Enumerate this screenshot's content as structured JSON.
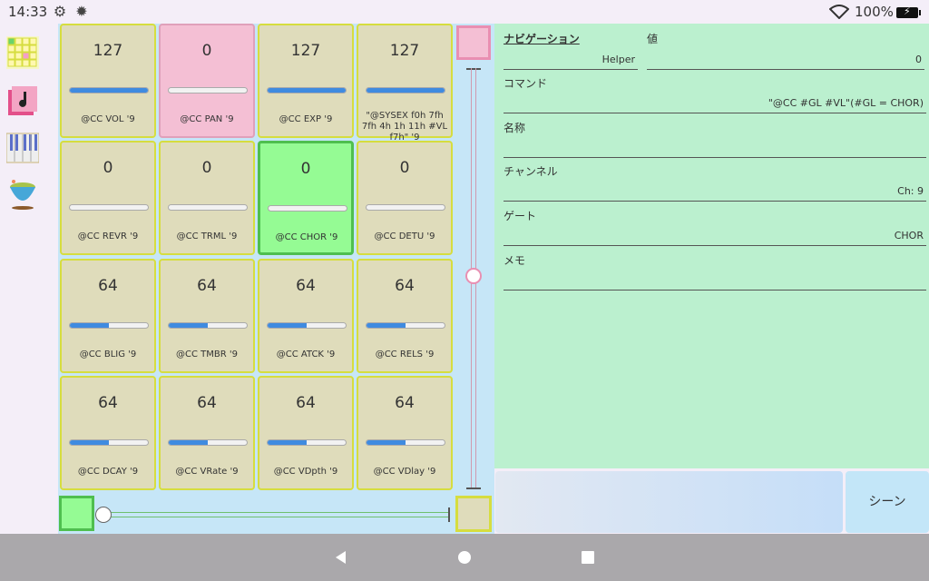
{
  "status": {
    "time": "14:33",
    "battery_pct": "100%",
    "icons": [
      "settings-gear-outline-icon",
      "settings-gear-icon",
      "wifi-icon",
      "battery-charging-icon"
    ]
  },
  "rail": {
    "apps": [
      "pad-grid-app-icon",
      "music-note-app-icon",
      "piano-keyboard-app-icon",
      "tea-bowl-app-icon"
    ]
  },
  "pads": [
    {
      "value": "127",
      "level": 1.0,
      "name": "@CC VOL '9",
      "style": "normal"
    },
    {
      "value": "0",
      "level": 0.0,
      "name": "@CC PAN '9",
      "style": "pink"
    },
    {
      "value": "127",
      "level": 1.0,
      "name": "@CC EXP '9",
      "style": "normal"
    },
    {
      "value": "127",
      "level": 1.0,
      "name": "\"@SYSEX f0h 7fh 7fh 4h 1h 11h #VL f7h\" '9",
      "style": "normal"
    },
    {
      "value": "0",
      "level": 0.0,
      "name": "@CC REVR '9",
      "style": "normal"
    },
    {
      "value": "0",
      "level": 0.0,
      "name": "@CC TRML '9",
      "style": "normal"
    },
    {
      "value": "0",
      "level": 0.0,
      "name": "@CC CHOR '9",
      "style": "green"
    },
    {
      "value": "0",
      "level": 0.0,
      "name": "@CC DETU '9",
      "style": "normal"
    },
    {
      "value": "64",
      "level": 0.5,
      "name": "@CC BLIG '9",
      "style": "normal"
    },
    {
      "value": "64",
      "level": 0.5,
      "name": "@CC TMBR '9",
      "style": "normal"
    },
    {
      "value": "64",
      "level": 0.5,
      "name": "@CC ATCK '9",
      "style": "normal"
    },
    {
      "value": "64",
      "level": 0.5,
      "name": "@CC RELS '9",
      "style": "normal"
    },
    {
      "value": "64",
      "level": 0.5,
      "name": "@CC DCAY '9",
      "style": "normal"
    },
    {
      "value": "64",
      "level": 0.5,
      "name": "@CC VRate '9",
      "style": "normal"
    },
    {
      "value": "64",
      "level": 0.5,
      "name": "@CC VDpth '9",
      "style": "normal"
    },
    {
      "value": "64",
      "level": 0.5,
      "name": "@CC VDlay '9",
      "style": "normal"
    }
  ],
  "panel": {
    "navigation_label": "ナビゲーション",
    "value_label": "値",
    "navigation_value": "Helper",
    "value_value": "0",
    "command_label": "コマンド",
    "command_value": "\"@CC #GL #VL\"(#GL = CHOR)",
    "name_label": "名称",
    "name_value": "",
    "channel_label": "チャンネル",
    "channel_value": "Ch: 9",
    "gate_label": "ゲート",
    "gate_value": "CHOR",
    "memo_label": "メモ",
    "memo_value": ""
  },
  "scene_button": "シーン",
  "navbar": {
    "icons": [
      "back-triangle-icon",
      "home-circle-icon",
      "recents-square-icon"
    ]
  },
  "colors": {
    "pad_bg": "#dfdcbb",
    "pad_border": "#d6dd3f",
    "pink_pad": "#f4bfd4",
    "green_pad": "#95fb94",
    "panel_bg": "#bbf0cf",
    "grid_bg": "#c6e6f7",
    "fill_blue": "#3f8be0"
  }
}
